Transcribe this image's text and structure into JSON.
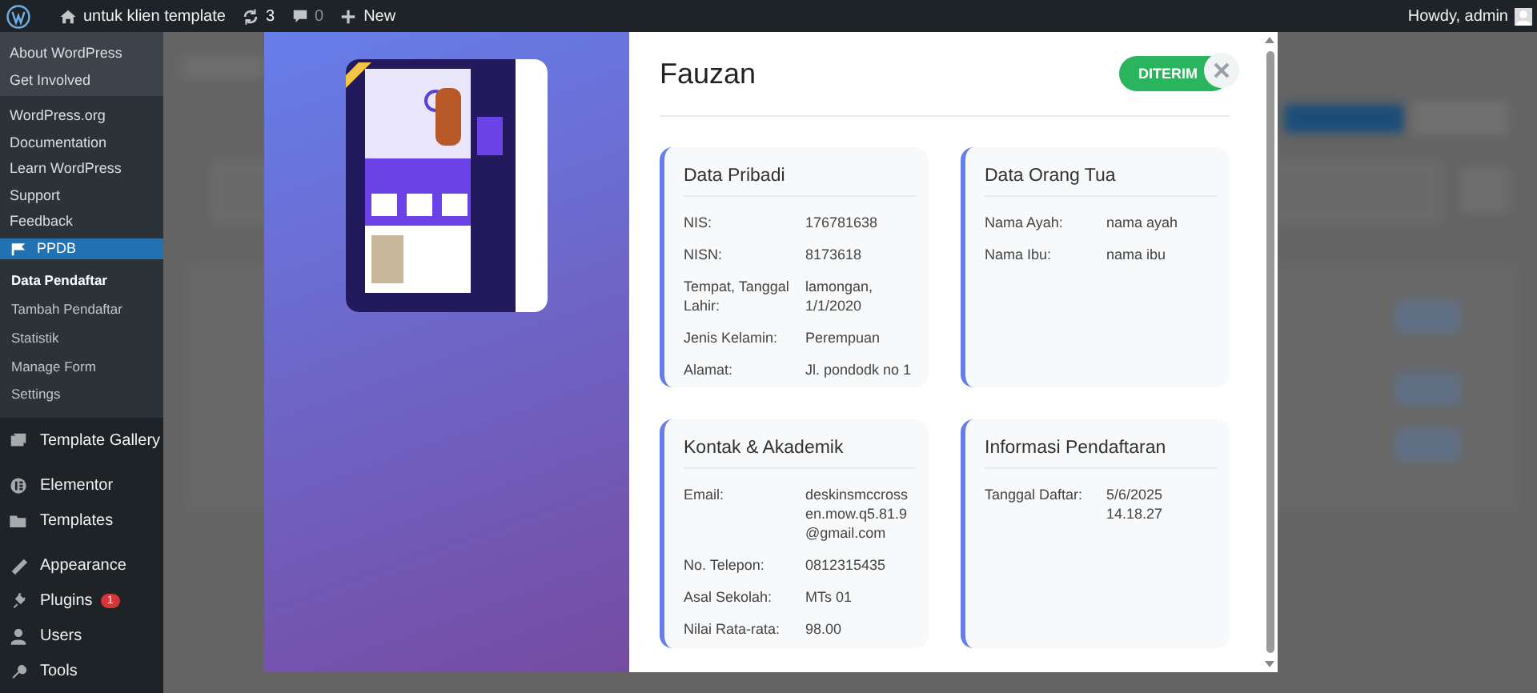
{
  "admin_bar": {
    "site_name": "untuk klien template",
    "updates": "3",
    "comments": "0",
    "new_label": "New",
    "greeting": "Howdy, admin"
  },
  "wp_menu": {
    "sections": [
      [
        "About WordPress",
        "Get Involved"
      ],
      [
        "WordPress.org",
        "Documentation",
        "Learn WordPress",
        "Support",
        "Feedback"
      ]
    ]
  },
  "sidebar": {
    "active": {
      "label": "PPDB",
      "selected": true,
      "submenu": [
        {
          "label": "Data Pendaftar",
          "selected": true
        },
        {
          "label": "Tambah Pendaftar",
          "selected": false
        },
        {
          "label": "Statistik",
          "selected": false
        },
        {
          "label": "Manage Form",
          "selected": false
        },
        {
          "label": "Settings",
          "selected": false
        }
      ]
    },
    "groups": [
      [
        {
          "label": "Template Gallery"
        }
      ],
      [
        {
          "label": "Elementor"
        },
        {
          "label": "Templates"
        }
      ],
      [
        {
          "label": "Appearance"
        },
        {
          "label": "Plugins",
          "badge": "1"
        },
        {
          "label": "Users"
        },
        {
          "label": "Tools"
        }
      ]
    ]
  },
  "modal": {
    "name": "Fauzan",
    "status": "DITERIM",
    "sections": [
      {
        "title": "Data Pribadi",
        "fields": [
          {
            "label": "NIS:",
            "value": "176781638"
          },
          {
            "label": "NISN:",
            "value": "8173618"
          },
          {
            "label": "Tempat, Tanggal Lahir:",
            "value": "lamongan, 1/1/2020"
          },
          {
            "label": "Jenis Kelamin:",
            "value": "Perempuan"
          },
          {
            "label": "Alamat:",
            "value": "Jl. pondodk no 1"
          }
        ]
      },
      {
        "title": "Data Orang Tua",
        "fields": [
          {
            "label": "Nama Ayah:",
            "value": "nama ayah"
          },
          {
            "label": "Nama Ibu:",
            "value": "nama ibu"
          }
        ]
      },
      {
        "title": "Kontak & Akademik",
        "fields": [
          {
            "label": "Email:",
            "value": "deskinsmccrossen.mow.q5.81.9@gmail.com"
          },
          {
            "label": "No. Telepon:",
            "value": "0812315435"
          },
          {
            "label": "Asal Sekolah:",
            "value": "MTs 01"
          },
          {
            "label": "Nilai Rata-rata:",
            "value": "98.00"
          }
        ]
      },
      {
        "title": "Informasi Pendaftaran",
        "fields": [
          {
            "label": "Tanggal Daftar:",
            "value": "5/6/2025 14.18.27"
          }
        ]
      }
    ]
  }
}
